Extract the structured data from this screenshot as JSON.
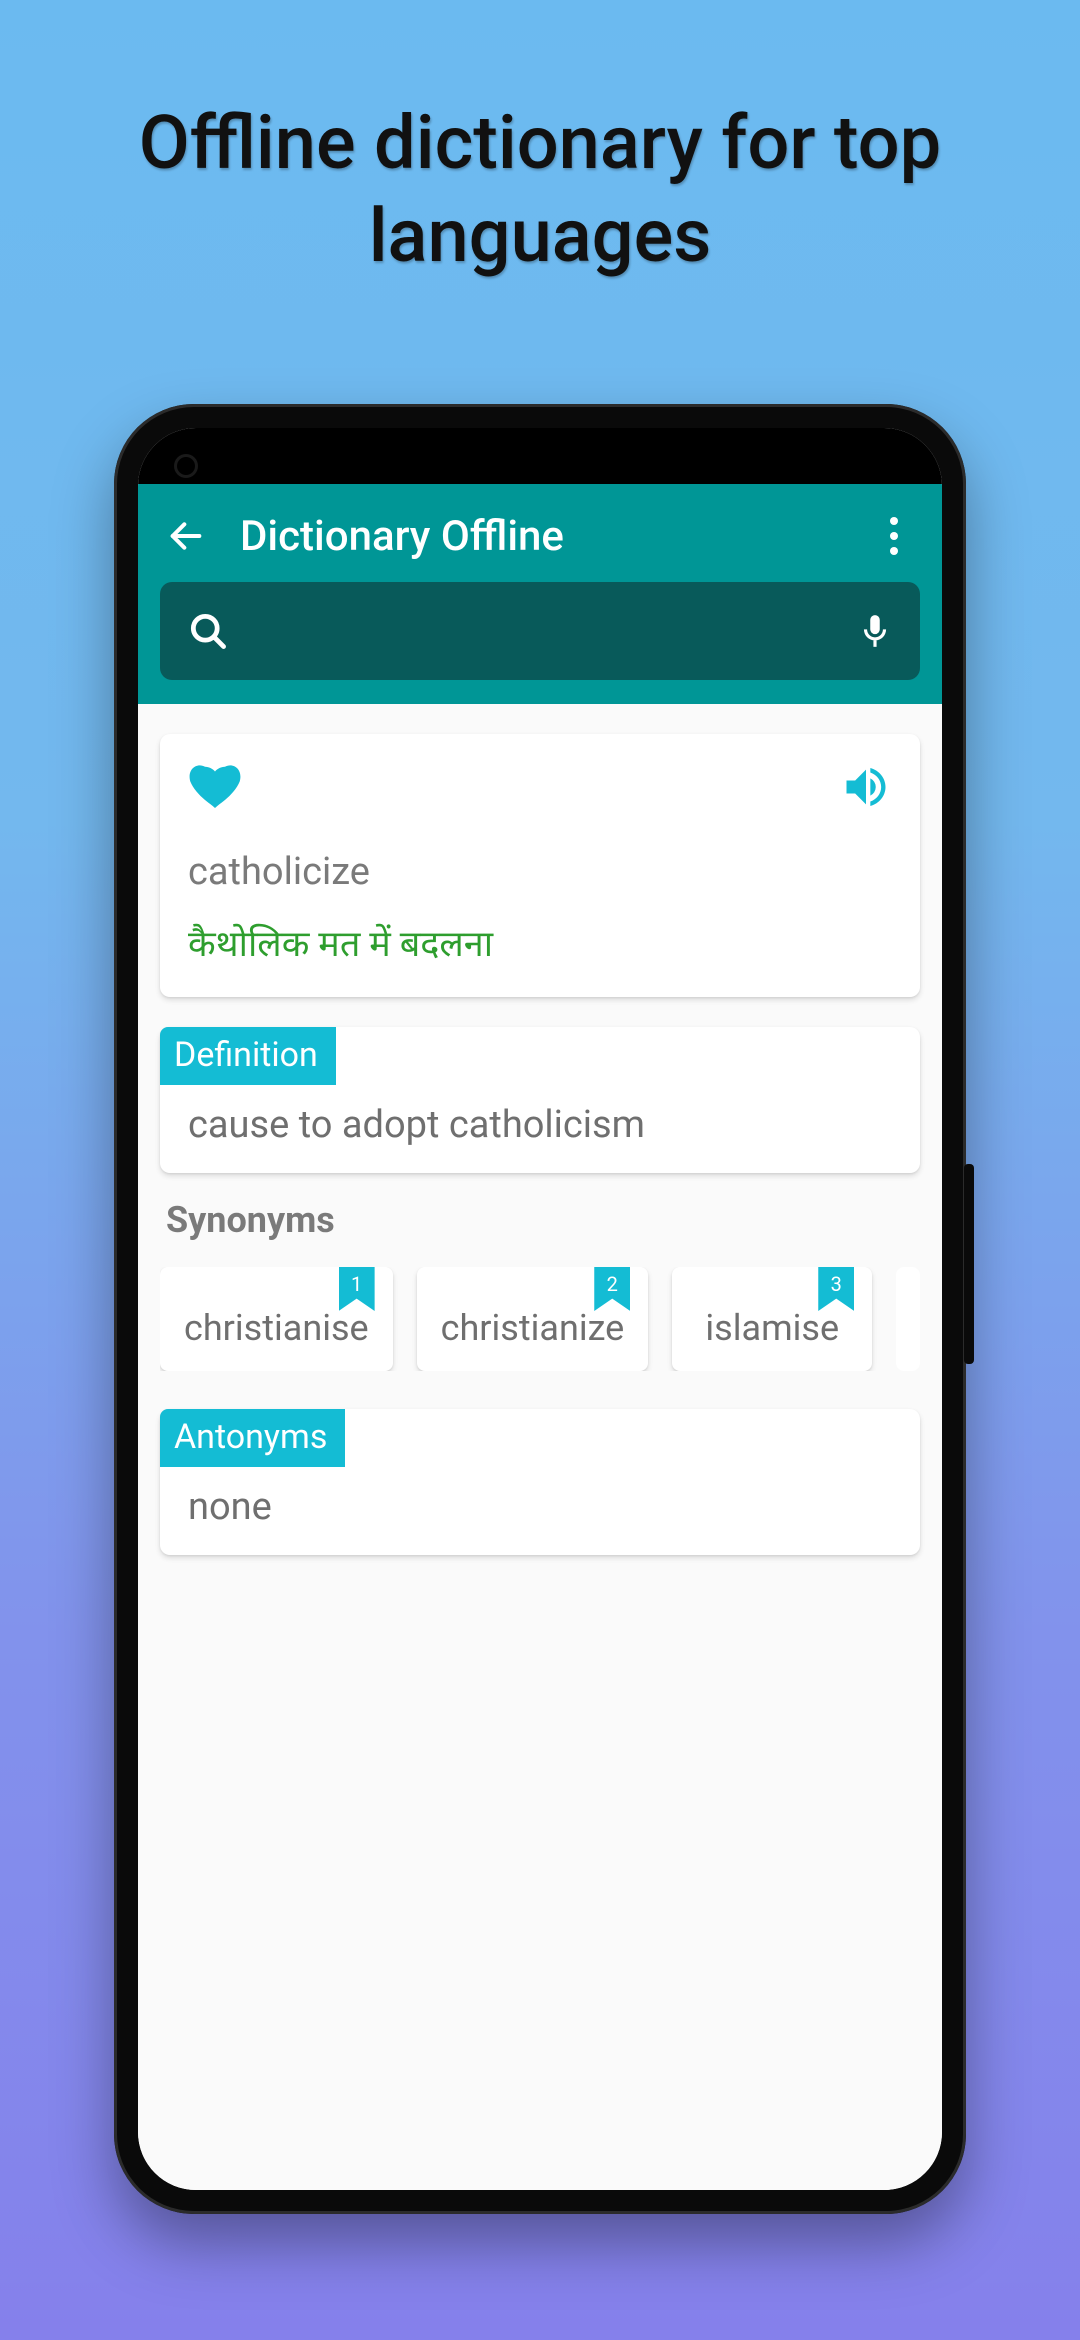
{
  "promo": {
    "title": "Offline dictionary for top\nlanguages"
  },
  "appbar": {
    "title": "Dictionary Offline"
  },
  "search": {
    "placeholder": ""
  },
  "word": {
    "english": "catholicize",
    "translation": "कैथोलिक मत में बदलना"
  },
  "definition": {
    "label": "Definition",
    "text": "cause to adopt catholicism"
  },
  "synonyms": {
    "label": "Synonyms",
    "items": [
      {
        "n": "1",
        "word": "christianise"
      },
      {
        "n": "2",
        "word": "christianize"
      },
      {
        "n": "3",
        "word": "islamise"
      }
    ]
  },
  "antonyms": {
    "label": "Antonyms",
    "text": "none"
  },
  "colors": {
    "brand": "#009696",
    "accent": "#14bcd4",
    "translation": "#2e9e2e"
  }
}
